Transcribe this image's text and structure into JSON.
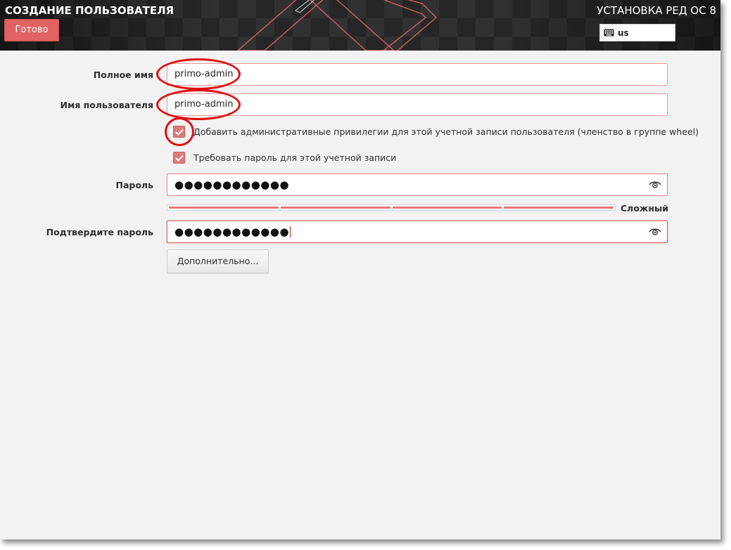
{
  "header": {
    "screen_title": "СОЗДАНИЕ ПОЛЬЗОВАТЕЛЯ",
    "product_title": "УСТАНОВКА РЕД ОС 8",
    "done_label": "Готово",
    "keyboard_layout": "us"
  },
  "form": {
    "full_name": {
      "label": "Полное имя",
      "value": "primo-admin"
    },
    "username": {
      "label": "Имя пользователя",
      "value": "primo-admin"
    },
    "admin_checkbox": {
      "label": "Добавить административные привилегии для этой учетной записи пользователя (членство в группе wheel)",
      "checked": true
    },
    "require_password_checkbox": {
      "label": "Требовать пароль для этой учетной записи",
      "checked": true
    },
    "password": {
      "label": "Пароль",
      "masked_value": "●●●●●●●●●●●●"
    },
    "strength": {
      "label": "Сложный",
      "level": 1.0
    },
    "confirm_password": {
      "label": "Подтвердите пароль",
      "masked_value": "●●●●●●●●●●●●"
    },
    "advanced_label": "Дополнительно..."
  },
  "icons": {
    "keyboard": "keyboard-icon",
    "reveal_password": "eye-icon",
    "check": "check-icon"
  },
  "colors": {
    "accent": "#e06262",
    "header_bg": "#262626",
    "window_bg": "#f2f2f2",
    "annotation": "#e01010"
  }
}
